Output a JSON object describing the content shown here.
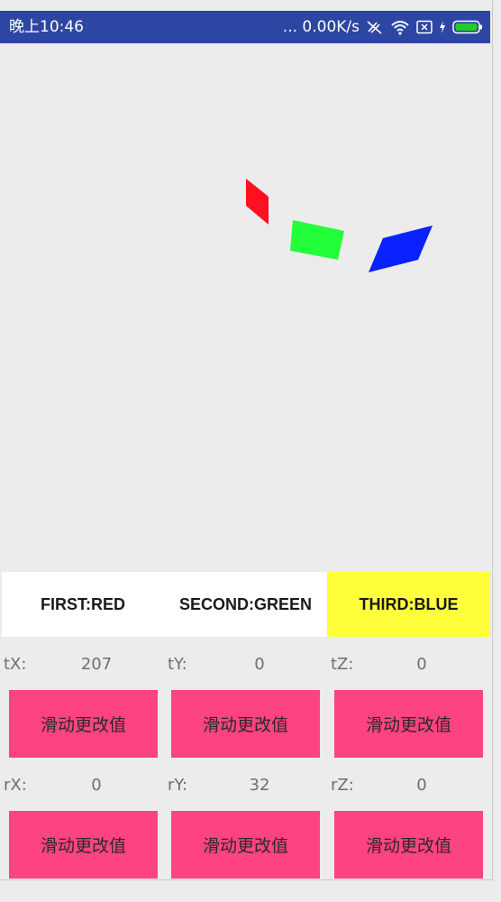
{
  "status_bar": {
    "time": "晚上10:46",
    "net_speed": "... 0.00K/s",
    "icons": [
      "signal-muted-icon",
      "wifi-icon",
      "sim-off-icon",
      "charging-icon",
      "battery-icon"
    ],
    "battery_color": "#22cc22"
  },
  "scene": {
    "shapes": [
      {
        "name": "red-plane",
        "color": "#ff0f1f"
      },
      {
        "name": "green-plane",
        "color": "#22ff3a"
      },
      {
        "name": "blue-plane",
        "color": "#0a22ff"
      }
    ]
  },
  "tabs": [
    {
      "label": "FIRST:RED",
      "selected": false
    },
    {
      "label": "SECOND:GREEN",
      "selected": false
    },
    {
      "label": "THIRD:BLUE",
      "selected": true
    }
  ],
  "translate": {
    "tx_label": "tX:",
    "tx_value": "207",
    "ty_label": "tY:",
    "ty_value": "0",
    "tz_label": "tZ:",
    "tz_value": "0"
  },
  "rotate": {
    "rx_label": "rX:",
    "rx_value": "0",
    "ry_label": "rY:",
    "ry_value": "32",
    "rz_label": "rZ:",
    "rz_value": "0"
  },
  "button_label": "滑动更改值",
  "colors": {
    "status_bar": "#2d45a3",
    "selected_tab": "#ffff3b",
    "button": "#fd4381",
    "background": "#ececec"
  }
}
